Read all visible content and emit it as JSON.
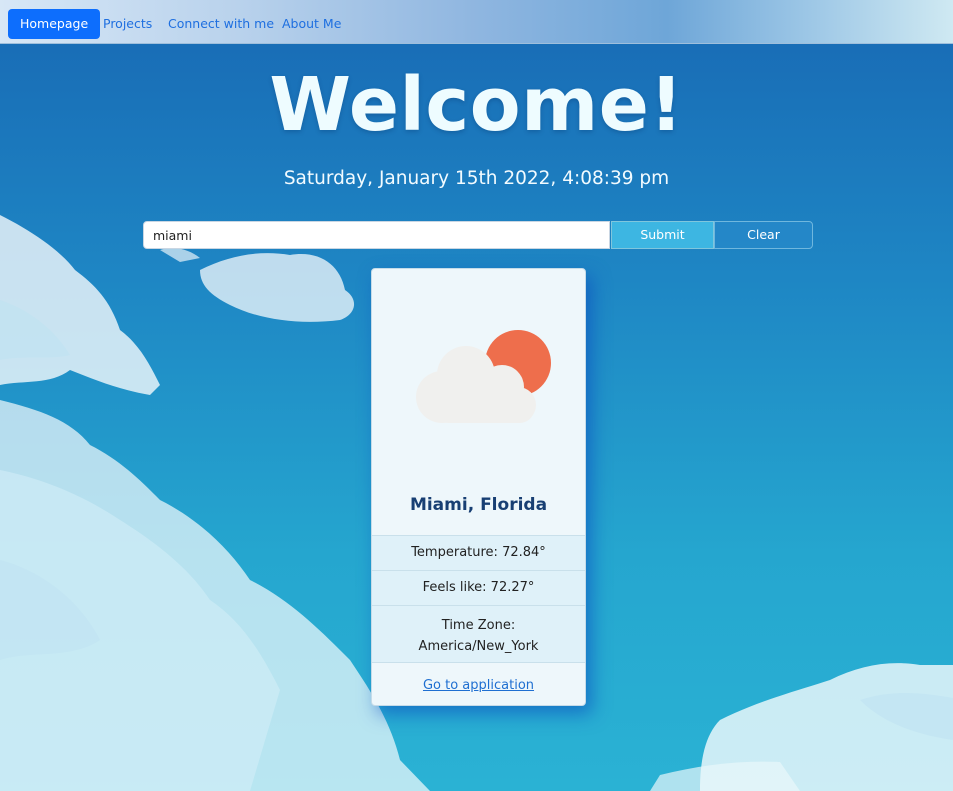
{
  "navbar": {
    "items": [
      {
        "label": "Homepage",
        "active": true
      },
      {
        "label": "Projects",
        "active": false
      },
      {
        "label": "Connect with me",
        "active": false
      },
      {
        "label": "About Me",
        "active": false
      }
    ]
  },
  "header": {
    "title": "Welcome!",
    "datetime": "Saturday, January 15th 2022, 4:08:39 pm"
  },
  "search": {
    "value": "miami",
    "submit_label": "Submit",
    "clear_label": "Clear"
  },
  "weather_card": {
    "icon": "partly-cloudy-day-icon",
    "location": "Miami, Florida",
    "temperature": "Temperature: 72.84°",
    "feels_like": "Feels like: 72.27°",
    "timezone_label": "Time Zone:",
    "timezone_value": "America/New_York",
    "link_label": "Go to application"
  },
  "colors": {
    "nav_active": "#0d6efd",
    "nav_link": "#1e6fe0",
    "submit_button": "#3db6e2",
    "card_title": "#183f73",
    "sun": "#ee6e4c",
    "cloud": "#f0f0ee"
  }
}
